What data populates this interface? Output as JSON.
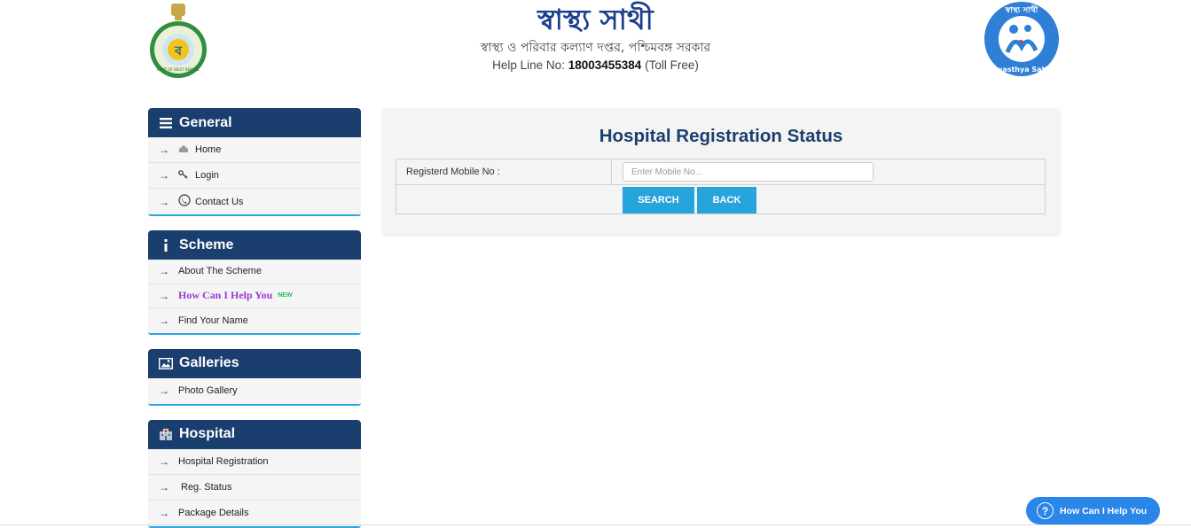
{
  "header": {
    "title": "স্বাস্থ্য সাথী",
    "subtitle": "স্বাস্থ্য ও পরিবার কল্যাণ দপ্তর, পশ্চিমবঙ্গ সরকার",
    "helpline_prefix": "Help Line No:",
    "helpline_number": "18003455384",
    "helpline_suffix": "(Toll Free)",
    "emblem_text": "GOVT OF WEST BENGAL",
    "logo_text_top": "স্বাস্থ্য সাথী",
    "logo_text_bottom": "Swasthya Sathi"
  },
  "sidebar": {
    "general": {
      "heading": "General",
      "items": [
        {
          "label": "Home",
          "icon": "home-icon"
        },
        {
          "label": "Login",
          "icon": "key-icon"
        },
        {
          "label": "Contact Us",
          "icon": "phone-icon"
        }
      ]
    },
    "scheme": {
      "heading": "Scheme",
      "items": [
        {
          "label": "About The Scheme"
        },
        {
          "label": "How Can I Help You",
          "badge": "NEW"
        },
        {
          "label": "Find Your Name"
        }
      ]
    },
    "galleries": {
      "heading": "Galleries",
      "items": [
        {
          "label": "Photo Gallery"
        }
      ]
    },
    "hospital": {
      "heading": "Hospital",
      "items": [
        {
          "label": "Hospital Registration"
        },
        {
          "label": "Reg. Status"
        },
        {
          "label": "Package Details"
        }
      ]
    }
  },
  "main": {
    "title": "Hospital Registration Status",
    "mobile_label": "Registerd Mobile No :",
    "mobile_placeholder": "Enter Mobile No...",
    "mobile_value": "",
    "search_label": "SEARCH",
    "back_label": "BACK"
  },
  "floating_help": {
    "label": "How Can I Help You"
  },
  "colors": {
    "panel_header": "#1a3e6e",
    "accent": "#28a4dc",
    "title": "#1a3e6e",
    "help_link": "#9a3ad6",
    "float_button": "#2a86e8"
  }
}
